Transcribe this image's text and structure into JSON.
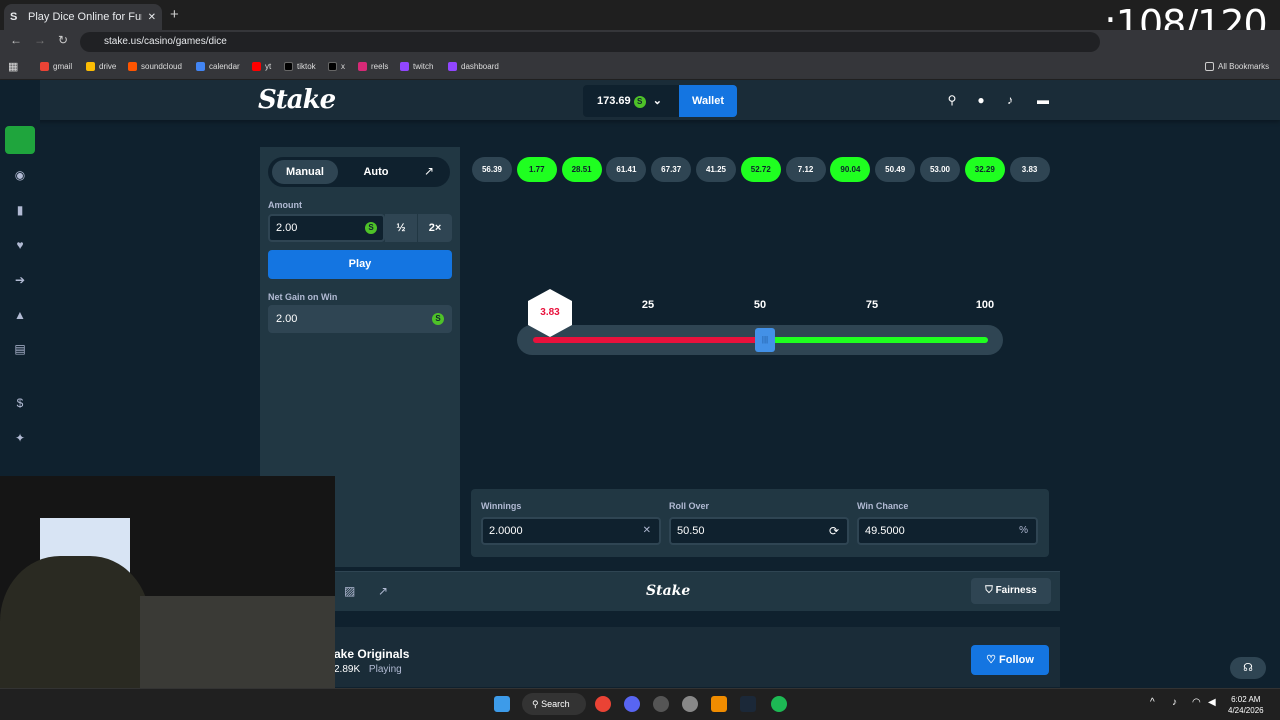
{
  "browser": {
    "tab_title": "Play Dice Online for Fun & |",
    "new_tab": "+",
    "url": "stake.us/casino/games/dice",
    "bookmarks": [
      "gmail",
      "drive",
      "soundcloud",
      "calendar",
      "yt",
      "tiktok",
      "x",
      "reels",
      "twitch",
      "dashboard"
    ],
    "all_bookmarks": "All Bookmarks",
    "overlay_counter": ":108/120"
  },
  "header": {
    "logo": "Stake",
    "balance": "173.69",
    "wallet_label": "Wallet"
  },
  "controls": {
    "tab_manual": "Manual",
    "tab_auto": "Auto",
    "amount_label": "Amount",
    "amount_value": "2.00",
    "half_label": "½",
    "double_label": "2×",
    "play_label": "Play",
    "net_gain_label": "Net Gain on Win",
    "net_gain_value": "2.00"
  },
  "history": [
    {
      "v": "56.39",
      "win": false
    },
    {
      "v": "1.77",
      "win": true
    },
    {
      "v": "28.51",
      "win": true
    },
    {
      "v": "61.41",
      "win": false
    },
    {
      "v": "67.37",
      "win": false
    },
    {
      "v": "41.25",
      "win": false
    },
    {
      "v": "52.72",
      "win": true
    },
    {
      "v": "7.12",
      "win": false
    },
    {
      "v": "90.04",
      "win": true
    },
    {
      "v": "50.49",
      "win": false
    },
    {
      "v": "53.00",
      "win": false
    },
    {
      "v": "32.29",
      "win": true
    },
    {
      "v": "3.83",
      "win": false
    }
  ],
  "slider": {
    "ticks": [
      "25",
      "50",
      "75",
      "100"
    ],
    "result": "3.83",
    "roll_over": 50.5
  },
  "stats": {
    "winnings_label": "Winnings",
    "winnings_value": "2.0000",
    "roll_over_label": "Roll Over",
    "roll_over_value": "50.50",
    "win_chance_label": "Win Chance",
    "win_chance_value": "49.5000",
    "win_chance_suffix": "%"
  },
  "footer": {
    "brand": "Stake",
    "fairness_label": "Fairness"
  },
  "originals": {
    "title": "ake Originals",
    "count": "2.89K",
    "playing": "Playing",
    "follow_label": "Follow"
  },
  "taskbar": {
    "search_label": "Search",
    "time": "6:02 AM",
    "date": "4/24/2026"
  },
  "colors": {
    "win": "#1fff20",
    "loss": "#e9113c",
    "accent": "#1475e1"
  }
}
